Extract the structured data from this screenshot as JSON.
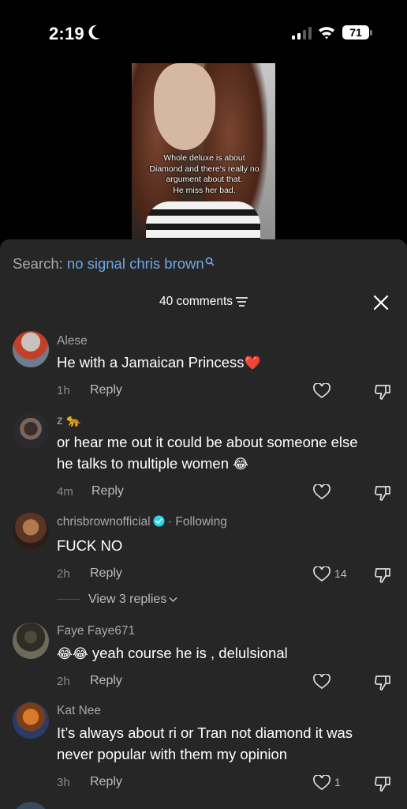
{
  "status_bar": {
    "time": "2:19",
    "battery": "71"
  },
  "video": {
    "caption_lines": [
      "Whole deluxe is about",
      "Diamond and there's really no",
      "argument about that.",
      "He miss her bad."
    ]
  },
  "search": {
    "label": "Search:",
    "term": "no signal chris brown"
  },
  "comments_header": {
    "count_label": "40 comments"
  },
  "comments": [
    {
      "username": "Alese",
      "text": "He with a Jamaican Princess",
      "emoji": "❤️",
      "time": "1h",
      "reply_label": "Reply",
      "likes": ""
    },
    {
      "username": "z 🐆",
      "text_line1": "or hear me out it could be about someone else",
      "text_line2": "he talks to multiple women",
      "emoji": "😂",
      "time": "4m",
      "reply_label": "Reply",
      "likes": ""
    },
    {
      "username": "chrisbrownofficial",
      "following_label": "· Following",
      "text": "FUCK NO",
      "time": "2h",
      "reply_label": "Reply",
      "likes": "14",
      "view_replies": "View 3 replies"
    },
    {
      "username": "Faye Faye671",
      "emoji": "😂😂",
      "text": "yeah course he is , delulsional",
      "time": "2h",
      "reply_label": "Reply",
      "likes": ""
    },
    {
      "username": "Kat Nee",
      "text_line1": "It’s always about ri or Tran not diamond it was",
      "text_line2": "never popular with them my opinion",
      "time": "3h",
      "reply_label": "Reply",
      "likes": "1"
    }
  ],
  "colors": {
    "sheet_bg": "#262626",
    "search_term": "#6fa8e6",
    "verified": "#20d5ec",
    "heart_red": "#e8302f"
  }
}
